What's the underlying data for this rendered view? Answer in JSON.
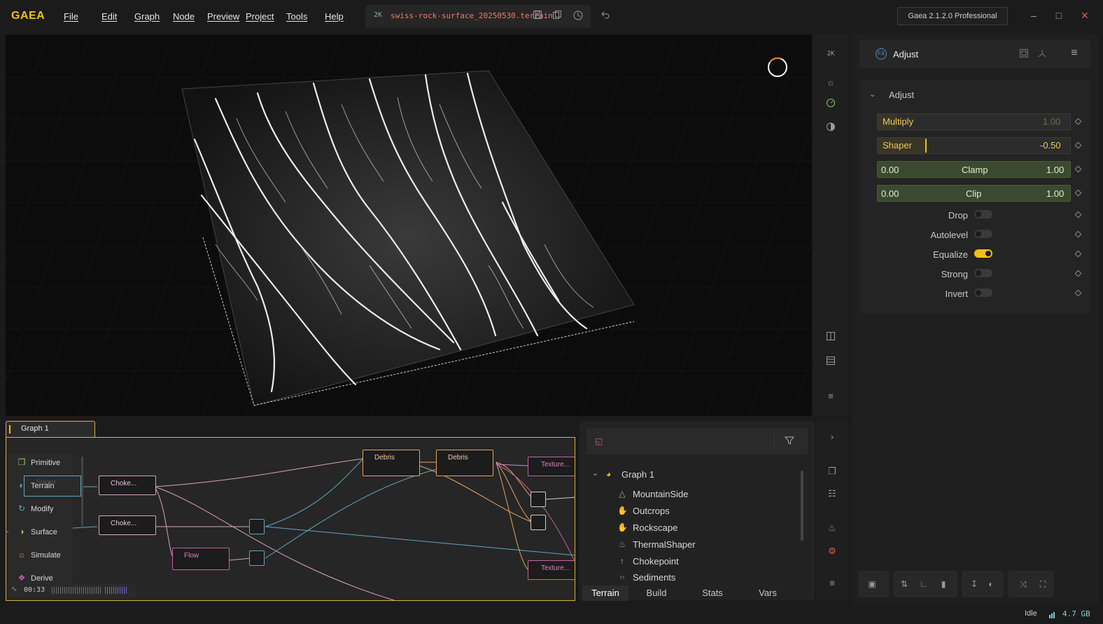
{
  "app": {
    "logo": "GAEA",
    "menu": [
      "File",
      "Edit",
      "Graph",
      "Node",
      "Preview",
      "Project",
      "Tools",
      "Help"
    ],
    "resolution_badge": "2K",
    "filename": "swiss-rock-surface_20250530.terrain",
    "edition": "Gaea 2.1.2.0 Professional"
  },
  "viewport": {
    "toolbar_badge": "2K"
  },
  "properties": {
    "node_badge": "FX",
    "header_title": "Adjust",
    "section_title": "Adjust",
    "multiply": {
      "label": "Multiply",
      "value": "1.00"
    },
    "shaper": {
      "label": "Shaper",
      "value": "-0.50"
    },
    "clamp": {
      "label": "Clamp",
      "min": "0.00",
      "max": "1.00"
    },
    "clip": {
      "label": "Clip",
      "min": "0.00",
      "max": "1.00"
    },
    "toggles": [
      {
        "label": "Drop",
        "on": false
      },
      {
        "label": "Autolevel",
        "on": false
      },
      {
        "label": "Equalize",
        "on": true
      },
      {
        "label": "Strong",
        "on": false
      },
      {
        "label": "Invert",
        "on": false
      }
    ]
  },
  "graph": {
    "tab_label": "Graph 1",
    "categories": [
      "Primitive",
      "Terrain",
      "Modify",
      "Surface",
      "Simulate",
      "Derive"
    ],
    "ghost_label": "Stages",
    "nodes": {
      "choke1": "Choke...",
      "choke2": "Choke...",
      "flow": "Flow",
      "debris1": "Debris",
      "debris2": "Debris",
      "texture1": "Texture...",
      "texture2": "Texture..."
    },
    "timer": "00:33"
  },
  "layers": {
    "root": "Graph 1",
    "items": [
      "MountainSide",
      "Outcrops",
      "Rockscape",
      "ThermalShaper",
      "Chokepoint",
      "Sediments"
    ],
    "tabs": [
      "Terrain",
      "Build",
      "Stats",
      "Vars"
    ]
  },
  "status": {
    "state": "Idle",
    "memory": "4.7 GB"
  },
  "colors": {
    "accent": "#f2c10f",
    "filename": "#e87e6f",
    "memory": "#7fd1d4"
  }
}
